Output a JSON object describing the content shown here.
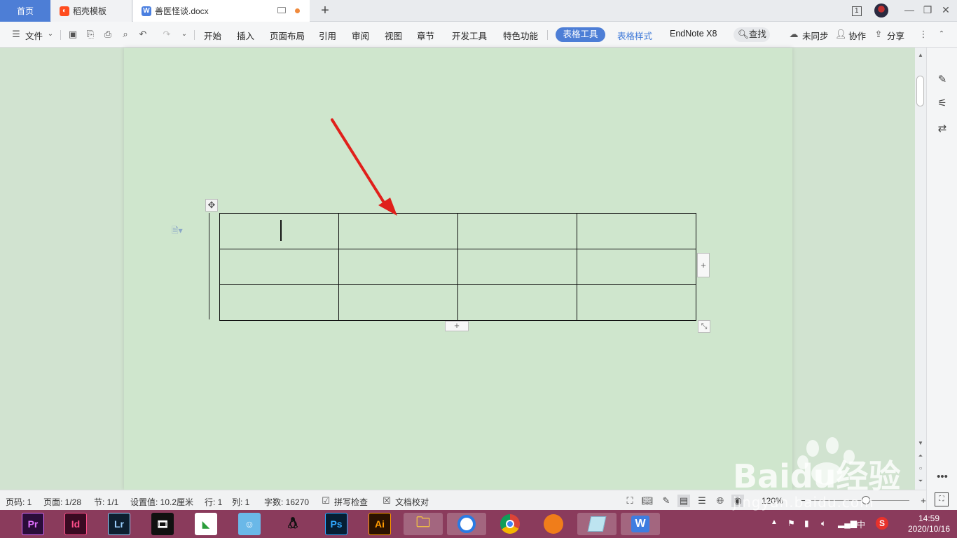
{
  "tabs": {
    "home": "首页",
    "docer": "稻壳模板",
    "doc": "善医怪谈.docx",
    "new_tab": "+",
    "badge": "1"
  },
  "menu": {
    "file": "文件",
    "start": "开始",
    "insert": "插入",
    "layout": "页面布局",
    "reference": "引用",
    "review": "审阅",
    "view": "视图",
    "chapter": "章节",
    "devtools": "开发工具",
    "features": "特色功能",
    "table_tools": "表格工具",
    "table_style": "表格样式",
    "endnote": "EndNote X8",
    "search": "查找",
    "unsync": "未同步",
    "collab": "协作",
    "share": "分享"
  },
  "table": {
    "rows": 3,
    "cols": 4
  },
  "status": {
    "page_num": "页码: 1",
    "pages": "页面: 1/28",
    "section": "节: 1/1",
    "setting": "设置值: 10.2厘米",
    "row": "行: 1",
    "col": "列: 1",
    "wordcount": "字数: 16270",
    "spellcheck": "拼写检查",
    "proofread": "文档校对",
    "zoom": "120%"
  },
  "taskbar": {
    "apps": [
      "Pr",
      "Id",
      "Lr",
      "Ps",
      "Ai"
    ],
    "ime": "中",
    "time": "14:59",
    "date": "2020/10/16"
  },
  "watermark": {
    "brand": "Baidu经验",
    "url": "jingyan.baidu.com"
  },
  "colors": {
    "accent": "#4d7ed6",
    "page_bg": "#cfe6cd",
    "taskbar": "#8a3b5c",
    "arrow": "#e0201b"
  }
}
